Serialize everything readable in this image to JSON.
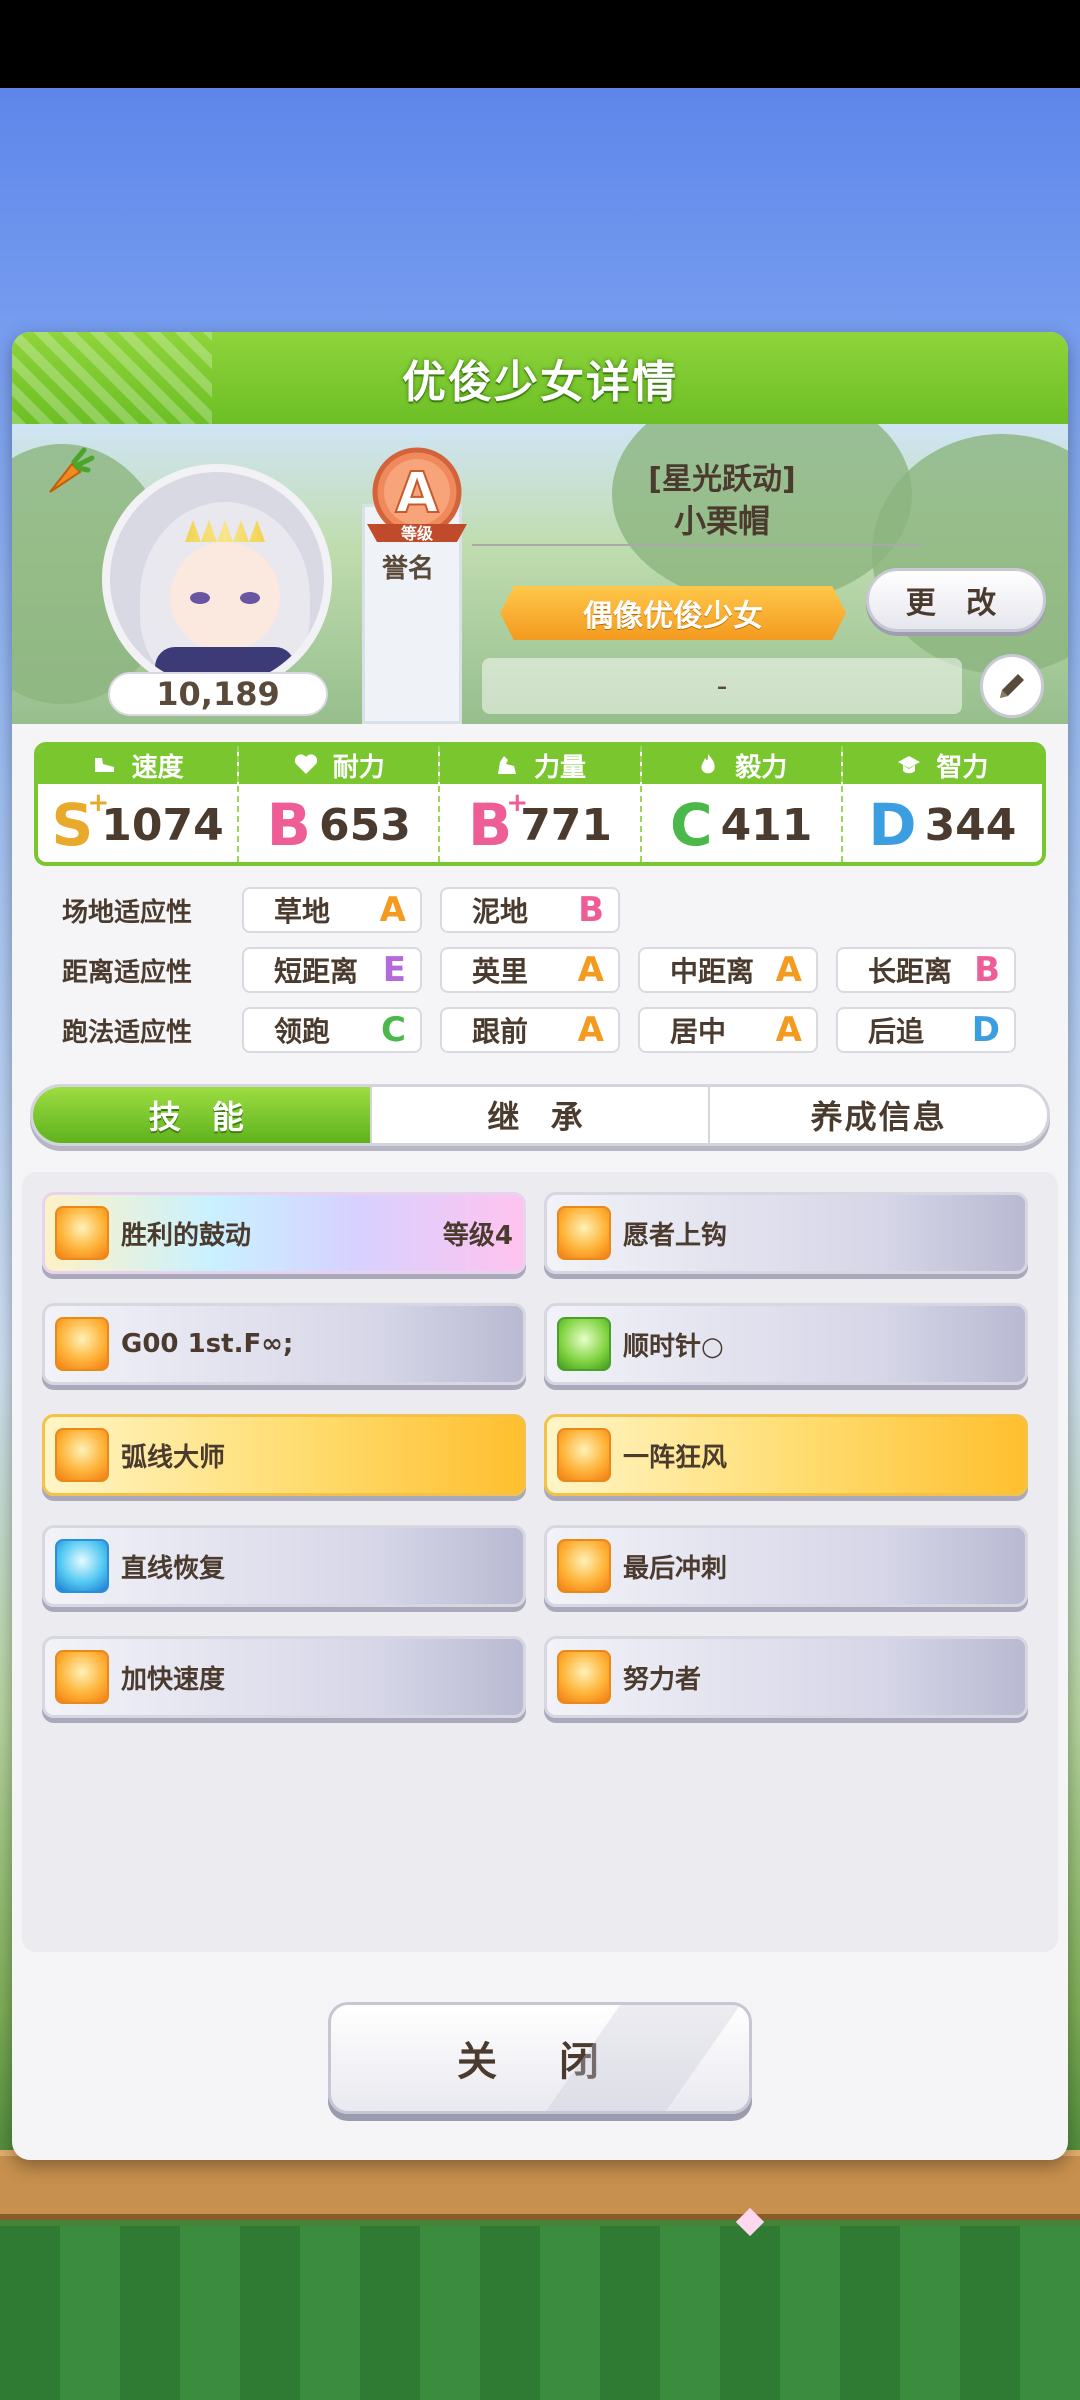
{
  "window": {
    "title": "优俊少女详情"
  },
  "profile": {
    "fans": "10,189",
    "rank_grade": "A",
    "rank_label": "等级",
    "rank_caption": "誉名",
    "costume_title": "[星光跃动]",
    "name": "小栗帽",
    "epithet": "偶像优俊少女",
    "change_label": "更 改",
    "motto": "-"
  },
  "stats": [
    {
      "label": "速度",
      "grade": "S",
      "plus": "+",
      "value": "1074",
      "icon": "shoe-icon",
      "color": "#e9a92a"
    },
    {
      "label": "耐力",
      "grade": "B",
      "plus": "",
      "value": "653",
      "icon": "heart-icon",
      "color": "#ef5d97"
    },
    {
      "label": "力量",
      "grade": "B",
      "plus": "+",
      "value": "771",
      "icon": "arm-icon",
      "color": "#ef5d97"
    },
    {
      "label": "毅力",
      "grade": "C",
      "plus": "",
      "value": "411",
      "icon": "flame-icon",
      "color": "#4ab84a"
    },
    {
      "label": "智力",
      "grade": "D",
      "plus": "",
      "value": "344",
      "icon": "graduation-cap-icon",
      "color": "#3b9ee0"
    }
  ],
  "aptitude": {
    "track": {
      "label": "场地适应性",
      "items": [
        {
          "name": "草地",
          "grade": "A",
          "color": "#f39a1f"
        },
        {
          "name": "泥地",
          "grade": "B",
          "color": "#ef5d97"
        }
      ]
    },
    "distance": {
      "label": "距离适应性",
      "items": [
        {
          "name": "短距离",
          "grade": "E",
          "color": "#b56ad9"
        },
        {
          "name": "英里",
          "grade": "A",
          "color": "#f39a1f"
        },
        {
          "name": "中距离",
          "grade": "A",
          "color": "#f39a1f"
        },
        {
          "name": "长距离",
          "grade": "B",
          "color": "#ef5d97"
        }
      ]
    },
    "style": {
      "label": "跑法适应性",
      "items": [
        {
          "name": "领跑",
          "grade": "C",
          "color": "#4ab84a"
        },
        {
          "name": "跟前",
          "grade": "A",
          "color": "#f39a1f"
        },
        {
          "name": "居中",
          "grade": "A",
          "color": "#f39a1f"
        },
        {
          "name": "后追",
          "grade": "D",
          "color": "#3b9ee0"
        }
      ]
    }
  },
  "tabs": [
    "技 能",
    "继 承",
    "养成信息"
  ],
  "skills": [
    {
      "name": "胜利的鼓动",
      "level": "等级4",
      "style": "rainbow",
      "icon": "running-figure-icon",
      "icon_color": "orange"
    },
    {
      "name": "愿者上钩",
      "level": "",
      "style": "normal",
      "icon": "running-figure-icon",
      "icon_color": "orange"
    },
    {
      "name": "G00 1st.F∞;",
      "level": "",
      "style": "normal",
      "icon": "running-figure-icon",
      "icon_color": "orange"
    },
    {
      "name": "顺时针○",
      "level": "",
      "style": "normal",
      "icon": "card-icon",
      "icon_color": "green"
    },
    {
      "name": "弧线大师",
      "level": "",
      "style": "gold",
      "icon": "running-figure-icon",
      "icon_color": "orange"
    },
    {
      "name": "一阵狂风",
      "level": "",
      "style": "gold",
      "icon": "running-figure-icon",
      "icon_color": "orange"
    },
    {
      "name": "直线恢复",
      "level": "",
      "style": "normal",
      "icon": "sparkle-icon",
      "icon_color": "blue"
    },
    {
      "name": "最后冲刺",
      "level": "",
      "style": "normal",
      "icon": "running-figure-icon",
      "icon_color": "orange"
    },
    {
      "name": "加快速度",
      "level": "",
      "style": "normal",
      "icon": "running-figure-icon",
      "icon_color": "orange"
    },
    {
      "name": "努力者",
      "level": "",
      "style": "normal",
      "icon": "running-figure-icon",
      "icon_color": "orange"
    }
  ],
  "close_label": "关 闭"
}
